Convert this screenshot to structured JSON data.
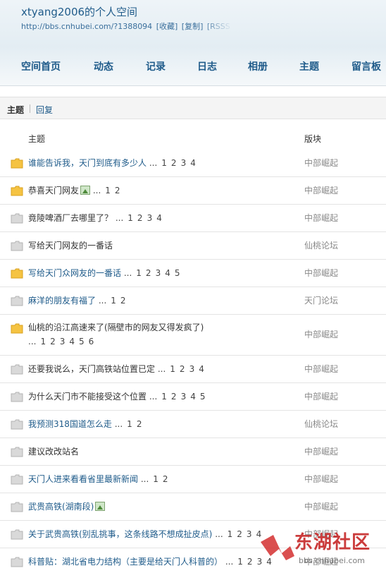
{
  "header": {
    "title": "xtyang2006的个人空间",
    "url_parts": [
      "http://bbs.cnhubei.com/?1388094",
      "[收藏]",
      "[复制]",
      "[RSSS"
    ]
  },
  "nav": {
    "items": [
      "空间首页",
      "动态",
      "记录",
      "日志",
      "相册",
      "主题",
      "留言板"
    ]
  },
  "subtabs": {
    "active": "主题",
    "other": "回复"
  },
  "table": {
    "col_title": "主题",
    "col_board": "版块",
    "rows": [
      {
        "title": "谁能告诉我，天门到底有多少人",
        "hot": true,
        "folder": "yellow",
        "img": false,
        "pages": [
          "1",
          "2",
          "3",
          "4"
        ],
        "board": "中部崛起"
      },
      {
        "title": "恭喜天门网友",
        "hot": false,
        "folder": "yellow",
        "img": true,
        "pages": [
          "1",
          "2"
        ],
        "board": "中部崛起"
      },
      {
        "title": "竟陵啤酒厂去哪里了？",
        "hot": false,
        "folder": "gray",
        "img": false,
        "pages": [
          "1",
          "2",
          "3",
          "4"
        ],
        "board": "中部崛起"
      },
      {
        "title": "写给天门网友的一番话",
        "hot": false,
        "folder": "gray",
        "img": false,
        "pages": [],
        "board": "仙桃论坛"
      },
      {
        "title": "写给天门众网友的一番话",
        "hot": true,
        "folder": "yellow",
        "img": false,
        "pages": [
          "1",
          "2",
          "3",
          "4",
          "5"
        ],
        "board": "中部崛起"
      },
      {
        "title": "麻洋的朋友有福了",
        "hot": true,
        "folder": "gray",
        "img": false,
        "pages": [
          "1",
          "2"
        ],
        "board": "天门论坛"
      },
      {
        "title": "仙桃的沿江高速来了(隔壁市的网友又得发疯了)",
        "hot": false,
        "folder": "yellow",
        "img": false,
        "pages": [
          "1",
          "2",
          "3",
          "4",
          "5",
          "6"
        ],
        "board": "中部崛起",
        "two_line": true
      },
      {
        "title": "还要我说么，天门高铁站位置已定",
        "hot": false,
        "folder": "gray",
        "img": false,
        "pages": [
          "1",
          "2",
          "3",
          "4"
        ],
        "board": "中部崛起"
      },
      {
        "title": "为什么天门市不能接受这个位置",
        "hot": false,
        "folder": "gray",
        "img": false,
        "pages": [
          "1",
          "2",
          "3",
          "4",
          "5"
        ],
        "board": "中部崛起"
      },
      {
        "title": "我预测318国道怎么走",
        "hot": true,
        "folder": "gray",
        "img": false,
        "pages": [
          "1",
          "2"
        ],
        "board": "仙桃论坛"
      },
      {
        "title": "建议改改站名",
        "hot": false,
        "folder": "gray",
        "img": false,
        "pages": [],
        "board": "中部崛起"
      },
      {
        "title": "天门人进来看看省里最新新闻",
        "hot": true,
        "folder": "gray",
        "img": false,
        "pages": [
          "1",
          "2"
        ],
        "board": "中部崛起"
      },
      {
        "title": "武贵高铁(湖南段)",
        "hot": true,
        "folder": "gray",
        "img": true,
        "pages": [],
        "board": "中部崛起"
      },
      {
        "title": "关于武贵高铁(别乱挑事，这条线路不想成扯皮点)",
        "hot": true,
        "folder": "gray",
        "img": false,
        "pages": [
          "1",
          "2",
          "3",
          "4"
        ],
        "board": "中部崛起"
      },
      {
        "title": "科普贴：湖北省电力结构（主要是给天门人科普的）",
        "hot": true,
        "folder": "gray",
        "img": false,
        "pages": [
          "1",
          "2",
          "3",
          "4"
        ],
        "board": "中部崛起"
      }
    ]
  },
  "watermark": {
    "text": "东湖社区",
    "sub": "bbs.cnhubei.com"
  },
  "colors": {
    "link": "#1f5b8a",
    "folder_yellow": "#f5c342",
    "folder_gray": "#d9d9d9",
    "board": "#8a8a8a"
  }
}
